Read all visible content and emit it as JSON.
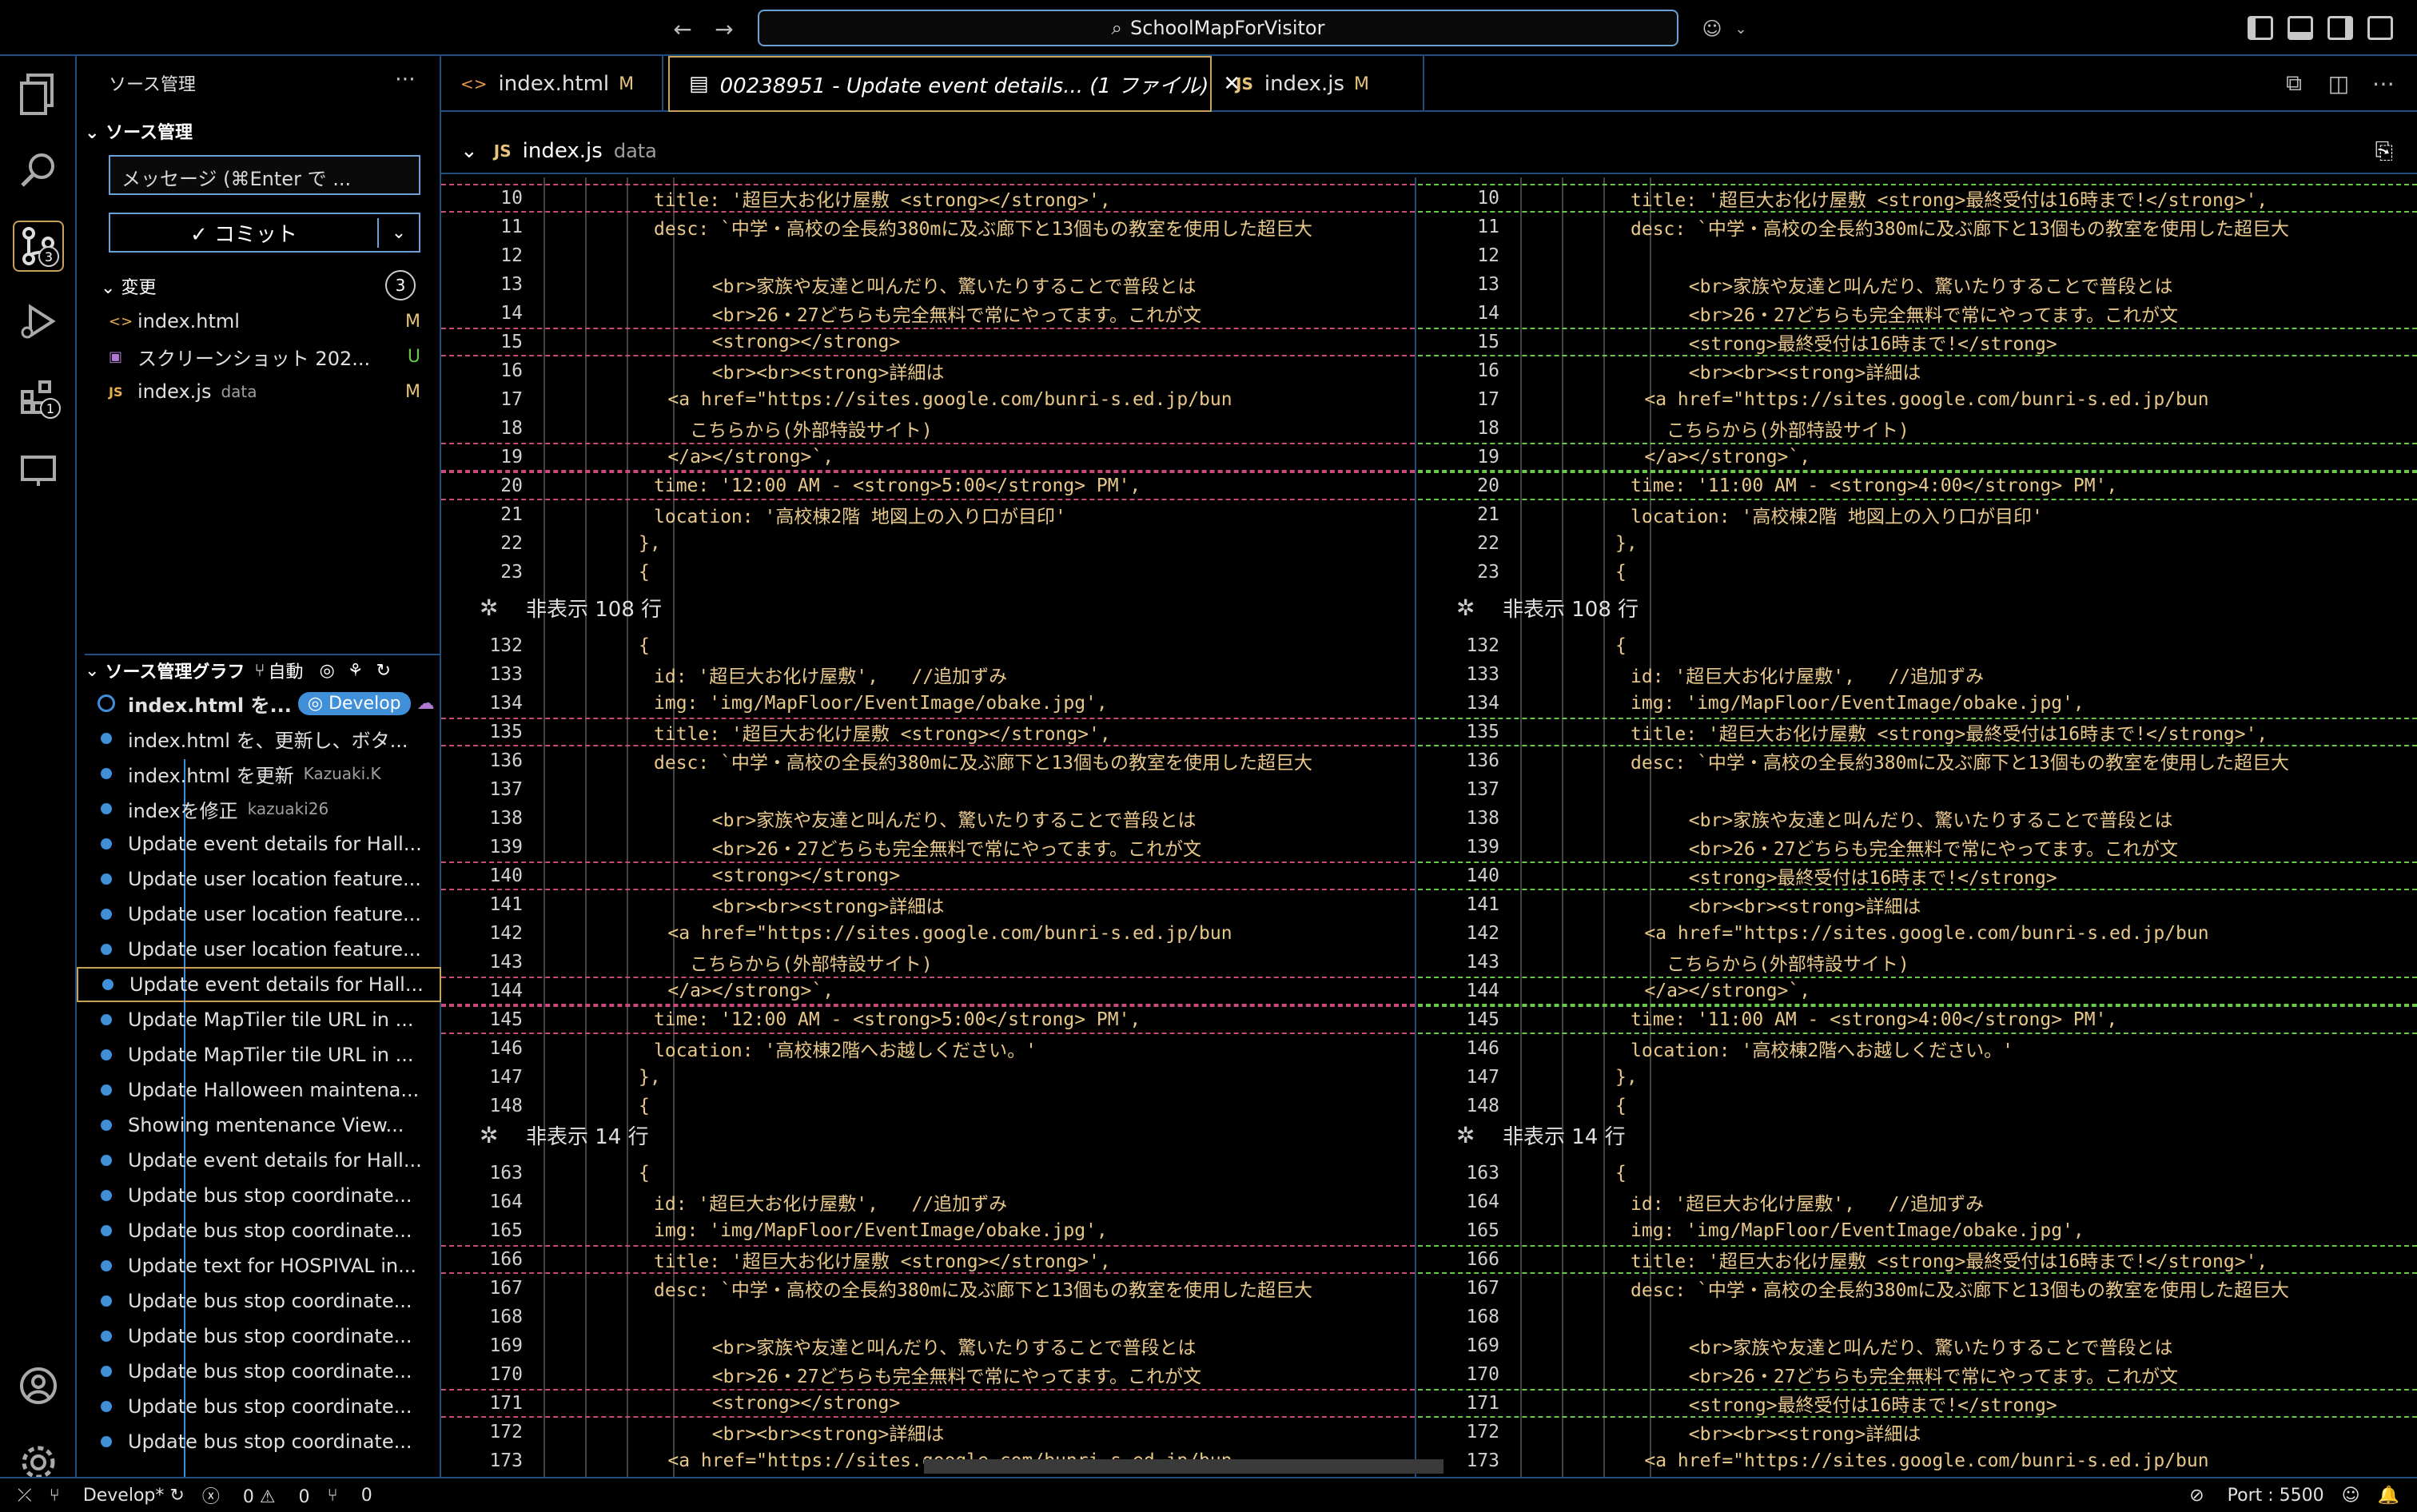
{
  "titlebar": {
    "search_text": "SchoolMapForVisitor"
  },
  "activity": {
    "scm_badge": "3",
    "extensions_badge": "1"
  },
  "sidebar": {
    "title": "ソース管理",
    "section_scm": "ソース管理",
    "message_placeholder": "メッセージ (⌘Enter で ...",
    "commit_label": "✓ コミット",
    "changes_label": "変更",
    "changes_count": "3",
    "files": [
      {
        "name": "index.html",
        "desc": "",
        "status": "M",
        "icon": "html-icon"
      },
      {
        "name": "スクリーンショット 202...",
        "desc": "",
        "status": "U",
        "icon": "image-icon"
      },
      {
        "name": "index.js",
        "desc": "data",
        "status": "M",
        "icon": "js-icon"
      }
    ],
    "graph_title": "ソース管理グラフ",
    "graph_auto": "自動",
    "graph": [
      {
        "text": "index.html を...",
        "pill": "Develop"
      },
      {
        "text": "index.html を、更新し、ボタ...",
        "author": ""
      },
      {
        "text": "index.html を更新",
        "author": "Kazuaki.K"
      },
      {
        "text": "indexを修正",
        "author": "kazuaki26"
      },
      {
        "text": "Update event details for Hall...",
        "author": ""
      },
      {
        "text": "Update user location feature...",
        "author": ""
      },
      {
        "text": "Update user location feature...",
        "author": ""
      },
      {
        "text": "Update user location feature...",
        "author": ""
      },
      {
        "text": "Update event details for Hall...",
        "author": ""
      },
      {
        "text": "Update MapTiler tile URL in ...",
        "author": ""
      },
      {
        "text": "Update MapTiler tile URL in ...",
        "author": ""
      },
      {
        "text": "Update Halloween maintena...",
        "author": ""
      },
      {
        "text": "Showing mentenance View...",
        "author": ""
      },
      {
        "text": "Update event details for Hall...",
        "author": ""
      },
      {
        "text": "Update bus stop coordinate...",
        "author": ""
      },
      {
        "text": "Update bus stop coordinate...",
        "author": ""
      },
      {
        "text": "Update text for HOSPIVAL in...",
        "author": ""
      },
      {
        "text": "Update bus stop coordinate...",
        "author": ""
      },
      {
        "text": "Update bus stop coordinate...",
        "author": ""
      },
      {
        "text": "Update bus stop coordinate...",
        "author": ""
      },
      {
        "text": "Update bus stop coordinate...",
        "author": ""
      },
      {
        "text": "Update bus stop coordinate...",
        "author": ""
      }
    ]
  },
  "tabs": [
    {
      "label": "index.html",
      "mod": "M",
      "kind": "html"
    },
    {
      "label": "00238951 - Update event details... (1 ファイル)",
      "mod": "",
      "kind": "diff"
    },
    {
      "label": "index.js",
      "mod": "M",
      "kind": "js"
    }
  ],
  "breadcrumb": {
    "file": "index.js",
    "desc": "data"
  },
  "diff": {
    "left": [
      {
        "n": "10",
        "t": "title: '超巨大お化け屋敷 <strong></strong>',",
        "kind": "del"
      },
      {
        "n": "11",
        "t": "desc: `中学・高校の全長約380mに及ぶ廊下と13個もの教室を使用した超巨大",
        "kind": ""
      },
      {
        "n": "12",
        "t": "",
        "kind": ""
      },
      {
        "n": "13",
        "t": "        <br>家族や友達と叫んだり、驚いたりすることで普段とは",
        "kind": ""
      },
      {
        "n": "14",
        "t": "        <br>26・27どちらも完全無料で常にやってます。これが文",
        "kind": ""
      },
      {
        "n": "15",
        "t": "        <strong></strong>",
        "kind": "del"
      },
      {
        "n": "16",
        "t": "        <br><br><strong>詳細は",
        "kind": ""
      },
      {
        "n": "17",
        "t": "    <a href=\"https://sites.google.com/bunri-s.ed.jp/bun",
        "kind": ""
      },
      {
        "n": "18",
        "t": "      こちらから(外部特設サイト)",
        "kind": ""
      },
      {
        "n": "19",
        "t": "    </a></strong>`,",
        "kind": "del"
      },
      {
        "n": "20",
        "t": "time: '12:00 AM - <strong>5:00</strong> PM',",
        "kind": "del"
      },
      {
        "n": "21",
        "t": "location: '高校棟2階 地図上の入り口が目印'",
        "kind": ""
      },
      {
        "n": "22",
        "t": "},",
        "kind": ""
      },
      {
        "n": "23",
        "t": "{",
        "kind": ""
      }
    ],
    "right": [
      {
        "n": "10",
        "t": "title: '超巨大お化け屋敷 <strong>最終受付は16時まで!</strong>',",
        "kind": "ins"
      },
      {
        "n": "11",
        "t": "desc: `中学・高校の全長約380mに及ぶ廊下と13個もの教室を使用した超巨大",
        "kind": ""
      },
      {
        "n": "12",
        "t": "",
        "kind": ""
      },
      {
        "n": "13",
        "t": "        <br>家族や友達と叫んだり、驚いたりすることで普段とは",
        "kind": ""
      },
      {
        "n": "14",
        "t": "        <br>26・27どちらも完全無料で常にやってます。これが文",
        "kind": ""
      },
      {
        "n": "15",
        "t": "        <strong>最終受付は16時まで!</strong>",
        "kind": "ins"
      },
      {
        "n": "16",
        "t": "        <br><br><strong>詳細は",
        "kind": ""
      },
      {
        "n": "17",
        "t": "    <a href=\"https://sites.google.com/bunri-s.ed.jp/bun",
        "kind": ""
      },
      {
        "n": "18",
        "t": "      こちらから(外部特設サイト)",
        "kind": ""
      },
      {
        "n": "19",
        "t": "    </a></strong>`,",
        "kind": "ins"
      },
      {
        "n": "20",
        "t": "time: '11:00 AM - <strong>4:00</strong> PM',",
        "kind": "ins"
      },
      {
        "n": "21",
        "t": "location: '高校棟2階 地図上の入り口が目印'",
        "kind": ""
      },
      {
        "n": "22",
        "t": "},",
        "kind": ""
      },
      {
        "n": "23",
        "t": "{",
        "kind": ""
      }
    ],
    "hidden1": "非表示 108 行",
    "left2": [
      {
        "n": "132",
        "t": "{",
        "kind": ""
      },
      {
        "n": "133",
        "t": "id: '超巨大お化け屋敷',   //追加ずみ",
        "kind": ""
      },
      {
        "n": "134",
        "t": "img: 'img/MapFloor/EventImage/obake.jpg',",
        "kind": ""
      },
      {
        "n": "135",
        "t": "title: '超巨大お化け屋敷 <strong></strong>',",
        "kind": "del"
      },
      {
        "n": "136",
        "t": "desc: `中学・高校の全長約380mに及ぶ廊下と13個もの教室を使用した超巨大",
        "kind": ""
      },
      {
        "n": "137",
        "t": "",
        "kind": ""
      },
      {
        "n": "138",
        "t": "        <br>家族や友達と叫んだり、驚いたりすることで普段とは",
        "kind": ""
      },
      {
        "n": "139",
        "t": "        <br>26・27どちらも完全無料で常にやってます。これが文",
        "kind": ""
      },
      {
        "n": "140",
        "t": "        <strong></strong>",
        "kind": "del"
      },
      {
        "n": "141",
        "t": "        <br><br><strong>詳細は",
        "kind": ""
      },
      {
        "n": "142",
        "t": "    <a href=\"https://sites.google.com/bunri-s.ed.jp/bun",
        "kind": ""
      },
      {
        "n": "143",
        "t": "      こちらから(外部特設サイト)",
        "kind": ""
      },
      {
        "n": "144",
        "t": "    </a></strong>`,",
        "kind": "del"
      },
      {
        "n": "145",
        "t": "time: '12:00 AM - <strong>5:00</strong> PM',",
        "kind": "del"
      },
      {
        "n": "146",
        "t": "location: '高校棟2階へお越しください。'",
        "kind": ""
      },
      {
        "n": "147",
        "t": "},",
        "kind": ""
      },
      {
        "n": "148",
        "t": "{",
        "kind": ""
      }
    ],
    "right2": [
      {
        "n": "132",
        "t": "{",
        "kind": ""
      },
      {
        "n": "133",
        "t": "id: '超巨大お化け屋敷',   //追加ずみ",
        "kind": ""
      },
      {
        "n": "134",
        "t": "img: 'img/MapFloor/EventImage/obake.jpg',",
        "kind": ""
      },
      {
        "n": "135",
        "t": "title: '超巨大お化け屋敷 <strong>最終受付は16時まで!</strong>',",
        "kind": "ins"
      },
      {
        "n": "136",
        "t": "desc: `中学・高校の全長約380mに及ぶ廊下と13個もの教室を使用した超巨大",
        "kind": ""
      },
      {
        "n": "137",
        "t": "",
        "kind": ""
      },
      {
        "n": "138",
        "t": "        <br>家族や友達と叫んだり、驚いたりすることで普段とは",
        "kind": ""
      },
      {
        "n": "139",
        "t": "        <br>26・27どちらも完全無料で常にやってます。これが文",
        "kind": ""
      },
      {
        "n": "140",
        "t": "        <strong>最終受付は16時まで!</strong>",
        "kind": "ins"
      },
      {
        "n": "141",
        "t": "        <br><br><strong>詳細は",
        "kind": ""
      },
      {
        "n": "142",
        "t": "    <a href=\"https://sites.google.com/bunri-s.ed.jp/bun",
        "kind": ""
      },
      {
        "n": "143",
        "t": "      こちらから(外部特設サイト)",
        "kind": ""
      },
      {
        "n": "144",
        "t": "    </a></strong>`,",
        "kind": "ins"
      },
      {
        "n": "145",
        "t": "time: '11:00 AM - <strong>4:00</strong> PM',",
        "kind": "ins"
      },
      {
        "n": "146",
        "t": "location: '高校棟2階へお越しください。'",
        "kind": ""
      },
      {
        "n": "147",
        "t": "},",
        "kind": ""
      },
      {
        "n": "148",
        "t": "{",
        "kind": ""
      }
    ],
    "hidden2": "非表示 14 行",
    "left3": [
      {
        "n": "163",
        "t": "{",
        "kind": ""
      },
      {
        "n": "164",
        "t": "id: '超巨大お化け屋敷',   //追加ずみ",
        "kind": ""
      },
      {
        "n": "165",
        "t": "img: 'img/MapFloor/EventImage/obake.jpg',",
        "kind": ""
      },
      {
        "n": "166",
        "t": "title: '超巨大お化け屋敷 <strong></strong>',",
        "kind": "del"
      },
      {
        "n": "167",
        "t": "desc: `中学・高校の全長約380mに及ぶ廊下と13個もの教室を使用した超巨大",
        "kind": ""
      },
      {
        "n": "168",
        "t": "",
        "kind": ""
      },
      {
        "n": "169",
        "t": "        <br>家族や友達と叫んだり、驚いたりすることで普段とは",
        "kind": ""
      },
      {
        "n": "170",
        "t": "        <br>26・27どちらも完全無料で常にやってます。これが文",
        "kind": ""
      },
      {
        "n": "171",
        "t": "        <strong></strong>",
        "kind": "del"
      },
      {
        "n": "172",
        "t": "        <br><br><strong>詳細は",
        "kind": ""
      },
      {
        "n": "173",
        "t": "    <a href=\"https://sites.google.com/bunri-s.ed.jp/bun",
        "kind": ""
      }
    ],
    "right3": [
      {
        "n": "163",
        "t": "{",
        "kind": ""
      },
      {
        "n": "164",
        "t": "id: '超巨大お化け屋敷',   //追加ずみ",
        "kind": ""
      },
      {
        "n": "165",
        "t": "img: 'img/MapFloor/EventImage/obake.jpg',",
        "kind": ""
      },
      {
        "n": "166",
        "t": "title: '超巨大お化け屋敷 <strong>最終受付は16時まで!</strong>',",
        "kind": "ins"
      },
      {
        "n": "167",
        "t": "desc: `中学・高校の全長約380mに及ぶ廊下と13個もの教室を使用した超巨大",
        "kind": ""
      },
      {
        "n": "168",
        "t": "",
        "kind": ""
      },
      {
        "n": "169",
        "t": "        <br>家族や友達と叫んだり、驚いたりすることで普段とは",
        "kind": ""
      },
      {
        "n": "170",
        "t": "        <br>26・27どちらも完全無料で常にやってます。これが文",
        "kind": ""
      },
      {
        "n": "171",
        "t": "        <strong>最終受付は16時まで!</strong>",
        "kind": "ins"
      },
      {
        "n": "172",
        "t": "        <br><br><strong>詳細は",
        "kind": ""
      },
      {
        "n": "173",
        "t": "    <a href=\"https://sites.google.com/bunri-s.ed.jp/bun",
        "kind": ""
      }
    ]
  },
  "status": {
    "branch": "Develop*",
    "errors": "0",
    "warnings": "0",
    "ports": "0",
    "port_label": "Port : 5500"
  }
}
